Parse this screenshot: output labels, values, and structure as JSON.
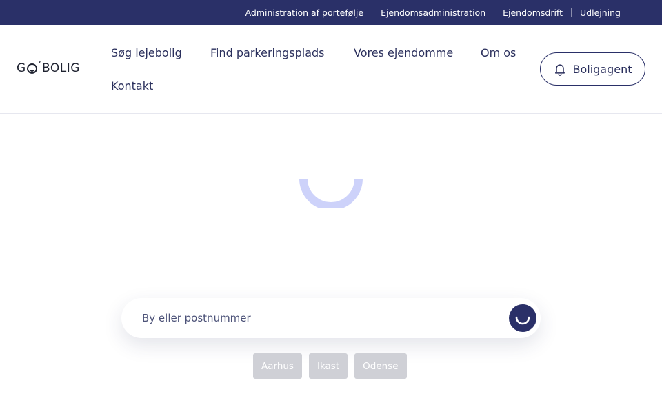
{
  "topbar": {
    "links": [
      "Administration af portefølje",
      "Ejendomsadministration",
      "Ejendomsdrift",
      "Udlejning"
    ]
  },
  "header": {
    "logo": {
      "part1": "G",
      "part2": "BOLIG"
    },
    "nav": [
      "Søg lejebolig",
      "Find parkeringsplads",
      "Vores ejendomme",
      "Om os",
      "Kontakt"
    ],
    "agent_button": "Boligagent"
  },
  "search": {
    "placeholder": "By eller postnummer",
    "value": ""
  },
  "quick_cities": [
    "Aarhus",
    "Ikast",
    "Odense"
  ],
  "colors": {
    "brand_dark": "#2a3068",
    "spinner": "#cdd2fa",
    "chip_bg": "#cfd0d6"
  }
}
